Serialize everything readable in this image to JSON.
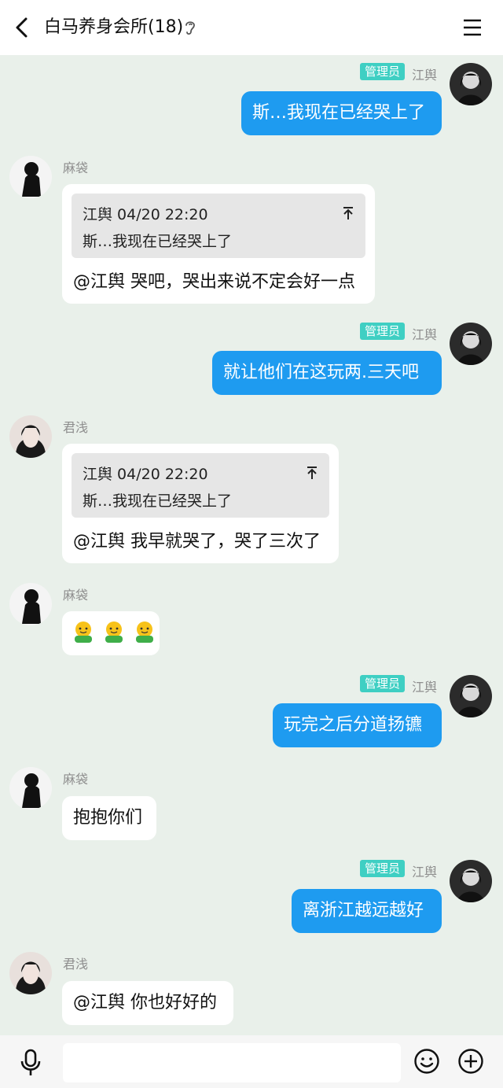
{
  "header": {
    "title": "白马养身会所(18)"
  },
  "self": {
    "name": "江舆",
    "badge": "管理员"
  },
  "messages": [
    {
      "text": "斯…我现在已经哭上了"
    },
    {
      "sender": "麻袋",
      "quote_head": "江舆 04/20 22:20",
      "quote_text": "斯…我现在已经哭上了",
      "text": "@江舆 哭吧，哭出来说不定会好一点"
    },
    {
      "text": "就让他们在这玩两.三天吧"
    },
    {
      "sender": "君浅",
      "quote_head": "江舆 04/20 22:20",
      "quote_text": "斯…我现在已经哭上了",
      "text": "@江舆 我早就哭了，哭了三次了"
    },
    {
      "sender": "麻袋",
      "emoji": "hug-emoji ×3"
    },
    {
      "text": "玩完之后分道扬镳"
    },
    {
      "sender": "麻袋",
      "text": "抱抱你们"
    },
    {
      "text": "离浙江越远越好"
    },
    {
      "sender": "君浅",
      "text": "@江舆 你也好好的"
    }
  ],
  "input": {
    "placeholder": ""
  },
  "colors": {
    "out_bubble": "#1e9bf0",
    "badge": "#3fcfc3",
    "background": "#e9f0ea"
  }
}
